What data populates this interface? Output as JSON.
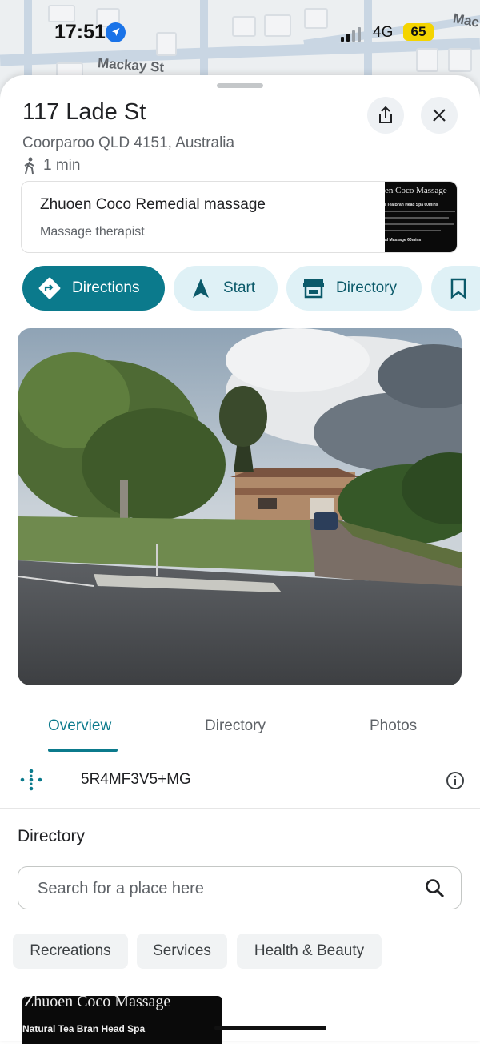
{
  "status_bar": {
    "time": "17:51",
    "network": "4G",
    "battery": "65",
    "signal_bars_filled": 2,
    "signal_bars_total": 4
  },
  "map": {
    "street_labels": [
      "Mackay St",
      "Mac"
    ]
  },
  "place": {
    "title": "117 Lade St",
    "address": "Coorparoo QLD 4151, Australia",
    "walk_time": "1 min"
  },
  "business": {
    "name": "Zhuoen Coco Remedial massage",
    "type": "Massage therapist",
    "thumb_title": "en Coco Massage",
    "thumb_line1": "l Tea Bran Head Spa   60mins",
    "thumb_line2": "al Massage          60mins"
  },
  "actions": [
    {
      "label": "Directions",
      "icon": "directions-icon"
    },
    {
      "label": "Start",
      "icon": "navigation-arrow-icon"
    },
    {
      "label": "Directory",
      "icon": "storefront-icon"
    },
    {
      "label": "",
      "icon": "bookmark-icon"
    }
  ],
  "tabs": [
    "Overview",
    "Directory",
    "Photos"
  ],
  "active_tab": "Overview",
  "plus_code": "5R4MF3V5+MG",
  "directory": {
    "heading": "Directory",
    "search_placeholder": "Search for a place here",
    "categories": [
      "Recreations",
      "Services",
      "Health & Beauty"
    ]
  },
  "bottom_card": {
    "title": "Zhuoen Coco Massage",
    "line": "Natural Tea Bran Head Spa"
  },
  "colors": {
    "accent": "#0b7a8c",
    "chip_bg": "#dff1f6",
    "battery": "#f4d400",
    "location": "#1a73e8"
  }
}
